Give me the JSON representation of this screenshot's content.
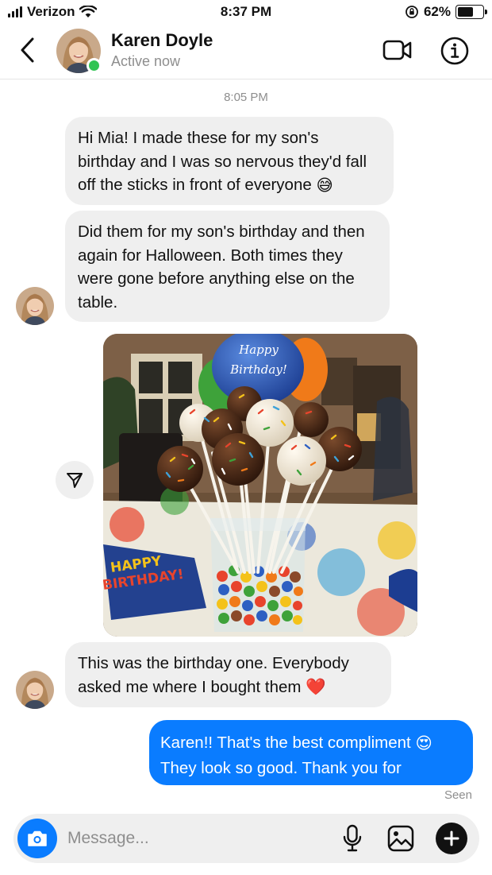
{
  "status_bar": {
    "carrier": "Verizon",
    "time": "8:37 PM",
    "battery_percent": "62%",
    "battery_level": 0.62,
    "icons": [
      "signal-icon",
      "wifi-icon",
      "orientation-lock-icon",
      "battery-icon"
    ]
  },
  "header": {
    "contact_name": "Karen Doyle",
    "contact_status": "Active now",
    "icons": [
      "back-chevron-icon",
      "video-call-icon",
      "info-icon"
    ]
  },
  "chat": {
    "timestamp": "8:05 PM",
    "messages": [
      {
        "from": "Karen Doyle",
        "text": "Hi Mia! I made these for my son's birthday and I was so nervous they'd fall off the sticks in front of everyone",
        "emoji": "😅"
      },
      {
        "from": "Karen Doyle",
        "text": "Did them for my son's birthday and then again for Halloween. Both times they were gone before anything else on the table."
      },
      {
        "from": "Karen Doyle",
        "type": "photo",
        "photo_text": [
          "Happy",
          "Birthday!",
          "HAPPY",
          "BIRTHDAY!"
        ]
      },
      {
        "from": "Karen Doyle",
        "text": "This was the birthday one. Everybody asked me where I bought them",
        "emoji": "❤️"
      },
      {
        "from": "me",
        "text_line1": "Karen!! That's the best compliment",
        "emoji": "😍",
        "text_line2": "They look so good. Thank you for sharing!"
      }
    ],
    "seen_label": "Seen"
  },
  "composer": {
    "placeholder": "Message...",
    "icons": [
      "camera-icon",
      "microphone-icon",
      "gallery-icon",
      "plus-icon"
    ]
  },
  "colors": {
    "accent": "#0a7cff",
    "incoming_bubble": "#efefef",
    "online": "#31c453",
    "muted_text": "#8e8e8e"
  }
}
